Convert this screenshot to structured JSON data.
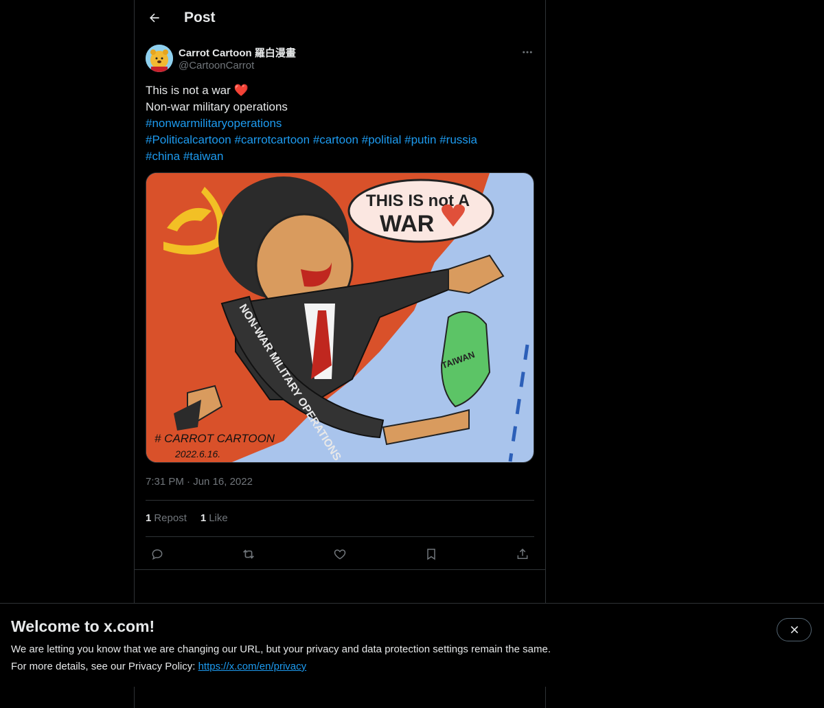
{
  "header": {
    "title": "Post"
  },
  "post": {
    "author_name": "Carrot Cartoon 羅白漫畫",
    "author_handle": "@CartoonCarrot",
    "text_line1": "This is not a war ",
    "text_line1_emoji": "❤️",
    "text_line2": "Non-war military operations",
    "hashtags_line3": [
      "#nonwarmilitaryoperations"
    ],
    "hashtags_line4": [
      "#Politicalcartoon",
      "#carrotcartoon",
      "#cartoon",
      "#politial",
      "#putin",
      "#russia"
    ],
    "hashtags_line5": [
      "#china",
      "#taiwan"
    ],
    "image": {
      "speech_bubble_line1": "THIS IS not A",
      "speech_bubble_line2": "WAR",
      "sash_text": "NON-WAR MILITARY OPERATIONS",
      "island_label": "TAIWAN",
      "signature_line1": "# CARROT CARTOON",
      "signature_line2": "2022.6.16."
    },
    "time": "7:31 PM",
    "separator": "·",
    "date": "Jun 16, 2022",
    "reposts_count": "1",
    "reposts_label": "Repost",
    "likes_count": "1",
    "likes_label": "Like"
  },
  "banner": {
    "title": "Welcome to x.com!",
    "line1": "We are letting you know that we are changing our URL, but your privacy and data protection settings remain the same.",
    "line2_prefix": "For more details, see our Privacy Policy: ",
    "link_text": "https://x.com/en/privacy"
  },
  "colors": {
    "background": "#000000",
    "text": "#e7e9ea",
    "muted": "#71767b",
    "accent": "#1d9bf0",
    "border": "#2f3336"
  },
  "icons": [
    "back-arrow-icon",
    "more-icon",
    "reply-icon",
    "repost-icon",
    "like-icon",
    "bookmark-icon",
    "share-icon",
    "close-icon"
  ]
}
